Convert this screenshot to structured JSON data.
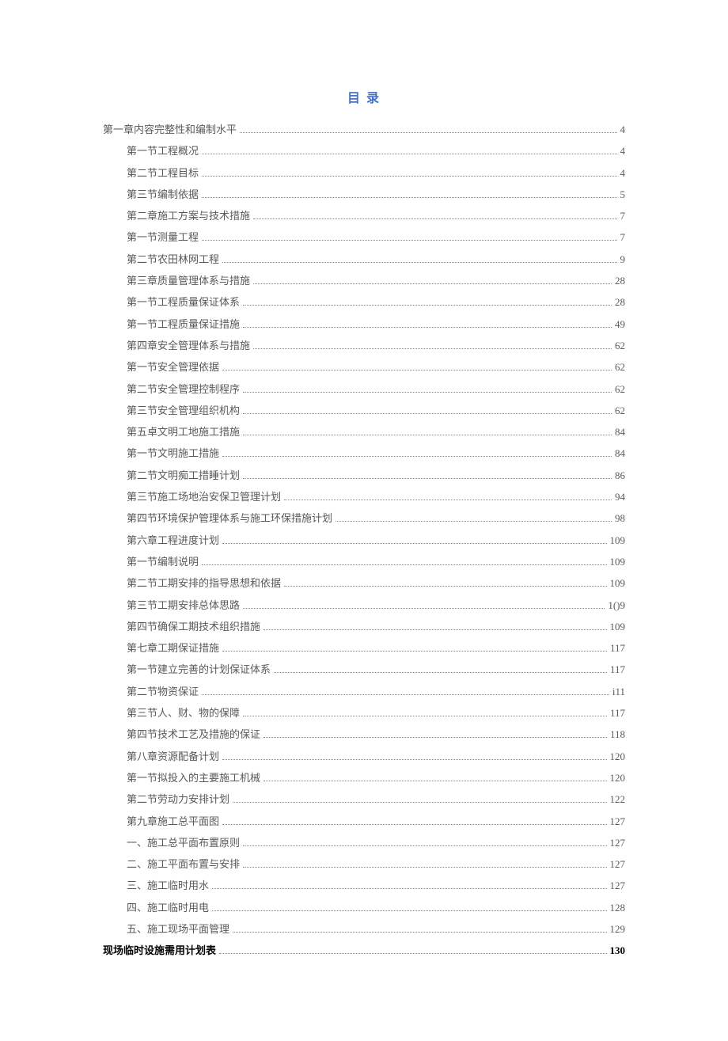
{
  "title": "目 录",
  "entries": [
    {
      "text": "第一章内容完整性和编制水平",
      "page": "4",
      "level": 0,
      "bold": false
    },
    {
      "text": "第一节工程概况",
      "page": "4",
      "level": 1,
      "bold": false
    },
    {
      "text": "第二节工程目标",
      "page": "4",
      "level": 1,
      "bold": false
    },
    {
      "text": "第三节编制依据",
      "page": "5",
      "level": 1,
      "bold": false
    },
    {
      "text": "第二章施工方案与技术措施",
      "page": "7",
      "level": 1,
      "bold": false
    },
    {
      "text": "第一节测量工程",
      "page": "7",
      "level": 1,
      "bold": false
    },
    {
      "text": "第二节农田林网工程",
      "page": "9",
      "level": 1,
      "bold": false
    },
    {
      "text": "第三章质量管理体系与措施",
      "page": "28",
      "level": 1,
      "bold": false
    },
    {
      "text": "第一节工程质量保证体系",
      "page": "28",
      "level": 1,
      "bold": false
    },
    {
      "text": "第一节工程质量保证措施",
      "page": "49",
      "level": 1,
      "bold": false
    },
    {
      "text": "第四章安全管理体系与措施",
      "page": "62",
      "level": 1,
      "bold": false
    },
    {
      "text": "第一节安全管理依据",
      "page": "62",
      "level": 1,
      "bold": false
    },
    {
      "text": "第二节安全管理控制程序",
      "page": "62",
      "level": 1,
      "bold": false
    },
    {
      "text": "第三节安全管理组织机构",
      "page": "62",
      "level": 1,
      "bold": false
    },
    {
      "text": "第五卓文明工地施工措施",
      "page": "84",
      "level": 1,
      "bold": false
    },
    {
      "text": "第一节文明施工措施",
      "page": "84",
      "level": 1,
      "bold": false
    },
    {
      "text": "第二节文明痴工措睡计划",
      "page": "86",
      "level": 1,
      "bold": false
    },
    {
      "text": "第三节施工场地治安保卫管理计划",
      "page": "94",
      "level": 1,
      "bold": false
    },
    {
      "text": "第四节环境保护管理体系与施工环保措施计划",
      "page": "98",
      "level": 1,
      "bold": false
    },
    {
      "text": "第六章工程进度计划",
      "page": "109",
      "level": 1,
      "bold": false
    },
    {
      "text": "第一节编制说明",
      "page": "109",
      "level": 1,
      "bold": false
    },
    {
      "text": "第二节工期安排的指导思想和依据",
      "page": "109",
      "level": 1,
      "bold": false
    },
    {
      "text": "第三节工期安排总体思路",
      "page": "1()9",
      "level": 1,
      "bold": false
    },
    {
      "text": "第四节确保工期技术组织措施",
      "page": "109",
      "level": 1,
      "bold": false
    },
    {
      "text": "第七章工期保证措施",
      "page": "117",
      "level": 1,
      "bold": false
    },
    {
      "text": "第一节建立完善的计划保证体系",
      "page": "117",
      "level": 1,
      "bold": false
    },
    {
      "text": "第二节物资保证",
      "page": "i11",
      "level": 1,
      "bold": false
    },
    {
      "text": "第三节人、财、物的保障",
      "page": "117",
      "level": 1,
      "bold": false
    },
    {
      "text": "第四节技术工艺及措施的保证",
      "page": "118",
      "level": 1,
      "bold": false
    },
    {
      "text": "第八章资源配备计划",
      "page": "120",
      "level": 1,
      "bold": false
    },
    {
      "text": "第一节拟投入的主要施工机械",
      "page": "120",
      "level": 1,
      "bold": false
    },
    {
      "text": "第二节劳动力安排计划",
      "page": "122",
      "level": 1,
      "bold": false
    },
    {
      "text": "第九章施工总平面图",
      "page": "127",
      "level": 1,
      "bold": false
    },
    {
      "text": "一、施工总平面布置原则",
      "page": "127",
      "level": 1,
      "bold": false
    },
    {
      "text": "二、施工平面布置与安排",
      "page": "127",
      "level": 1,
      "bold": false
    },
    {
      "text": "三、施工临时用水",
      "page": "127",
      "level": 1,
      "bold": false
    },
    {
      "text": "四、施工临时用电",
      "page": "128",
      "level": 1,
      "bold": false
    },
    {
      "text": "五、施工现场平面管理",
      "page": "129",
      "level": 1,
      "bold": false
    },
    {
      "text": "现场临时设施需用计划表",
      "page": "130",
      "level": 0,
      "bold": true
    }
  ]
}
